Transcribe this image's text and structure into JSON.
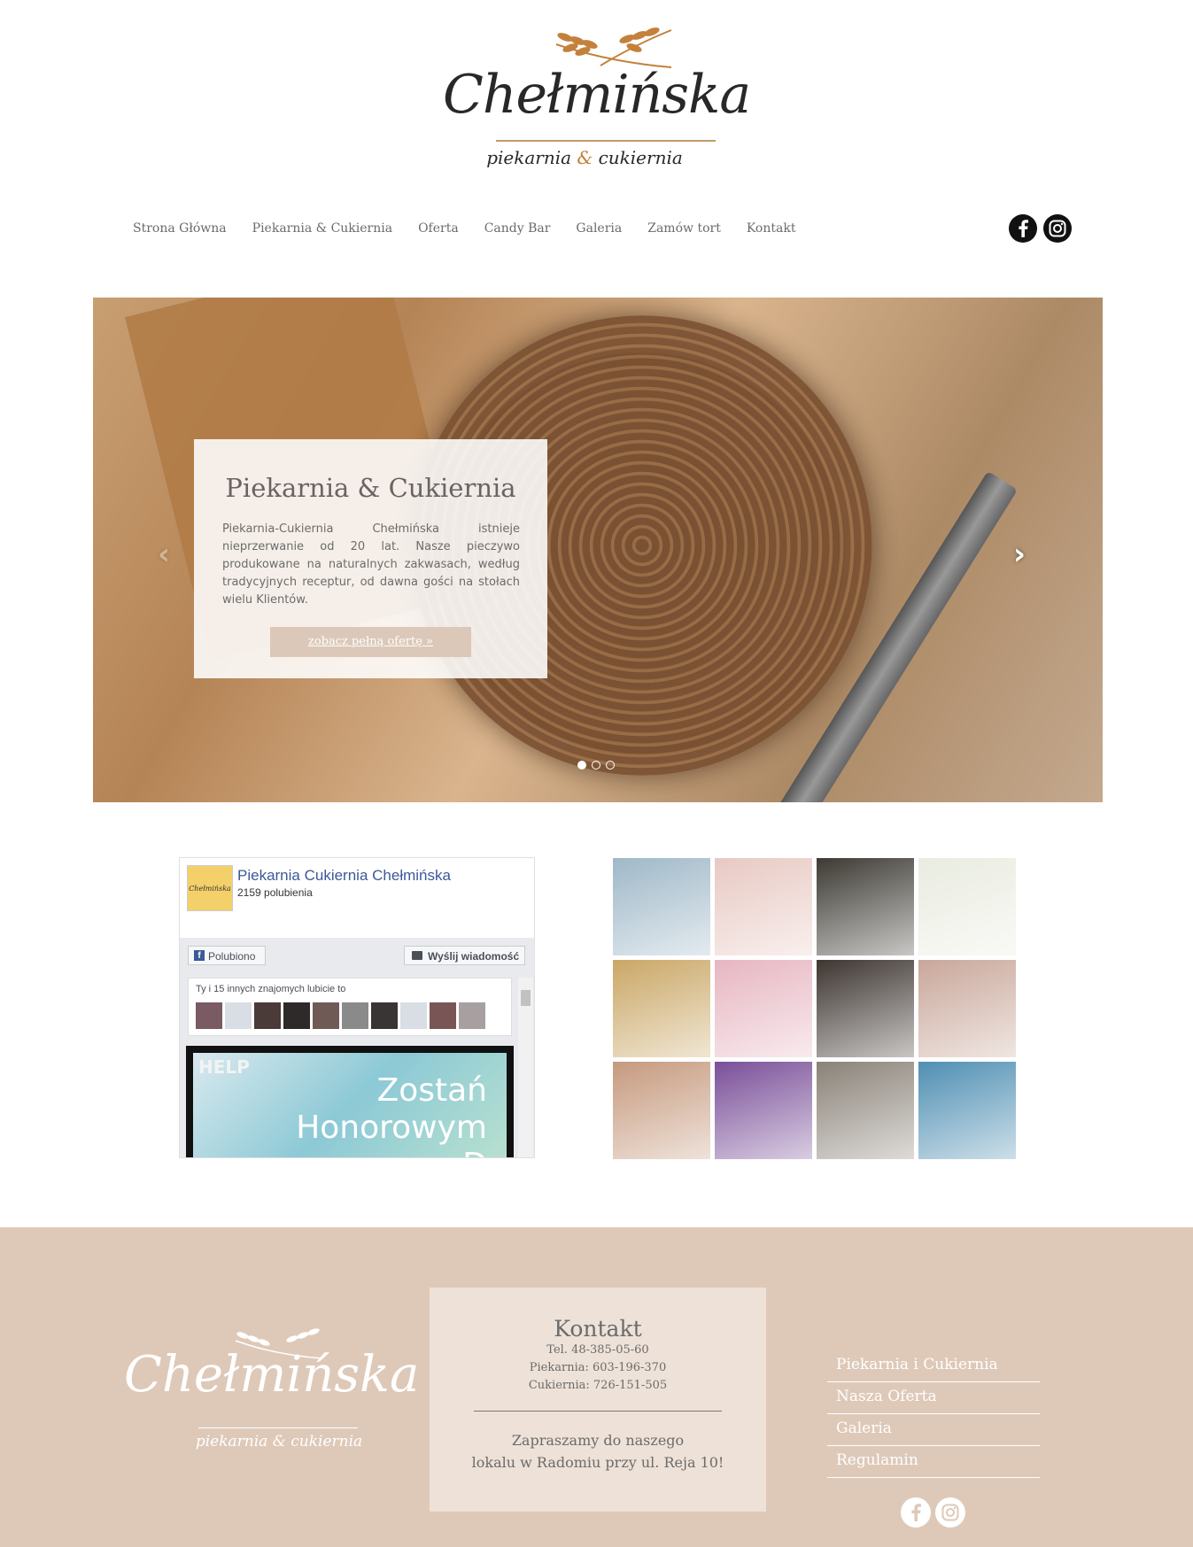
{
  "header": {
    "logo_name": "Chełmińska",
    "logo_tagline_1": "piekarnia",
    "logo_tagline_amp": "&",
    "logo_tagline_2": "cukiernia"
  },
  "nav": {
    "items": [
      "Strona Główna",
      "Piekarnia & Cukiernia",
      "Oferta",
      "Candy Bar",
      "Galeria",
      "Zamów tort",
      "Kontakt"
    ]
  },
  "social": {
    "facebook": "facebook-icon",
    "instagram": "instagram-icon"
  },
  "hero": {
    "title": "Piekarnia & Cukiernia",
    "text": "Piekarnia-Cukiernia Chełmińska istnieje nieprzerwanie od 20 lat. Nasze pieczywo produkowane na naturalnych zakwasach, według tradycyjnych receptur, od dawna gości na stołach wielu Klientów.",
    "button": "zobacz pełną ofertę »",
    "prev_arrow": "‹",
    "next_arrow": "›",
    "slides_count": 3,
    "active_slide": 1
  },
  "facebook_widget": {
    "page_name": "Piekarnia Cukiernia Chełmińska",
    "likes": "2159 polubienia",
    "liked_button": "Polubiono",
    "message_button": "Wyślij wiadomość",
    "friends_text": "Ty i 15 innych znajomych lubicie to",
    "post_tag": "HELP",
    "post_text": "Zostań Honorowym D"
  },
  "instagram_grid": {
    "tiles": [
      "cake-pops",
      "floral-cake",
      "cupcakes",
      "rose-cake",
      "dessert-table",
      "pink-tier-cake",
      "balloon-arch",
      "mini-desserts",
      "dessert-bar",
      "spider-cake",
      "grey-cake",
      "fireman-cake"
    ],
    "colors": [
      "#9fb8c8",
      "#e8c9c3",
      "#3d3a33",
      "#e9ece0",
      "#caa766",
      "#e7b6c2",
      "#3d3530",
      "#c9a79a",
      "#c69a7e",
      "#7a4f99",
      "#8a8278",
      "#4f8fb3"
    ]
  },
  "footer": {
    "logo_name": "Chełmińska",
    "logo_tagline": "piekarnia & cukiernia",
    "contact_title": "Kontakt",
    "phone": "Tel. 48-385-05-60",
    "bakery": "Piekarnia: 603-196-370",
    "confectionery": "Cukiernia: 726-151-505",
    "invite_line_1": "Zapraszamy do naszego",
    "invite_line_2": "lokalu w Radomiu przy ul. Reja 10!",
    "links": [
      "Piekarnia i Cukiernia",
      "Nasza Oferta",
      "Galeria",
      "Regulamin"
    ]
  },
  "colors": {
    "footer_bg": "#dec9b9",
    "contact_box_bg": "#eee1d7",
    "button_bg": "#dbc8b8",
    "logo_accent": "#c4813c",
    "facebook_blue": "#3b5998"
  }
}
